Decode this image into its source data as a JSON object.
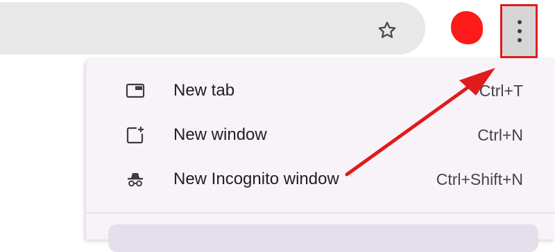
{
  "toolbar": {
    "bookmark_icon": "star-outline-icon",
    "menu_icon": "three-dots-vertical-icon",
    "avatar_color": "#ff1a1a"
  },
  "menu": {
    "items": [
      {
        "label": "New tab",
        "shortcut": "Ctrl+T",
        "icon": "new-tab-icon"
      },
      {
        "label": "New window",
        "shortcut": "Ctrl+N",
        "icon": "new-window-icon"
      },
      {
        "label": "New Incognito window",
        "shortcut": "Ctrl+Shift+N",
        "icon": "incognito-icon"
      }
    ]
  },
  "annotation": {
    "highlight_color": "#e01b1b",
    "arrow_color": "#e01b1b"
  }
}
